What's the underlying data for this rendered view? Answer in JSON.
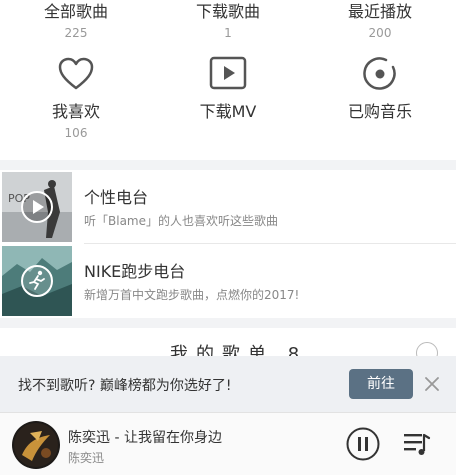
{
  "top_grid": [
    {
      "label": "全部歌曲",
      "count": "225"
    },
    {
      "label": "下载歌曲",
      "count": "1"
    },
    {
      "label": "最近播放",
      "count": "200"
    },
    {
      "label": "我喜欢",
      "count": "106",
      "icon": "heart-icon"
    },
    {
      "label": "下载MV",
      "count": "",
      "icon": "video-play-icon"
    },
    {
      "label": "已购音乐",
      "count": "",
      "icon": "purchased-disc-icon"
    }
  ],
  "radios": [
    {
      "title": "个性电台",
      "subtitle": "听「Blame」的人也喜欢听这些歌曲",
      "icon": "play-circle-icon"
    },
    {
      "title": "NIKE跑步电台",
      "subtitle": "新增万首中文跑步歌曲，点燃你的2017!",
      "icon": "runner-icon"
    }
  ],
  "my_songlist": {
    "title": "我的歌单 8"
  },
  "promo": {
    "text": "找不到歌听? 巅峰榜都为你选好了!",
    "button": "前往"
  },
  "player": {
    "song": "陈奕迅 - 让我留在你身边",
    "artist": "陈奕迅"
  },
  "colors": {
    "accent": "#5b7184",
    "band": "#f2f3f5",
    "promo_bg": "#eef0f3"
  }
}
